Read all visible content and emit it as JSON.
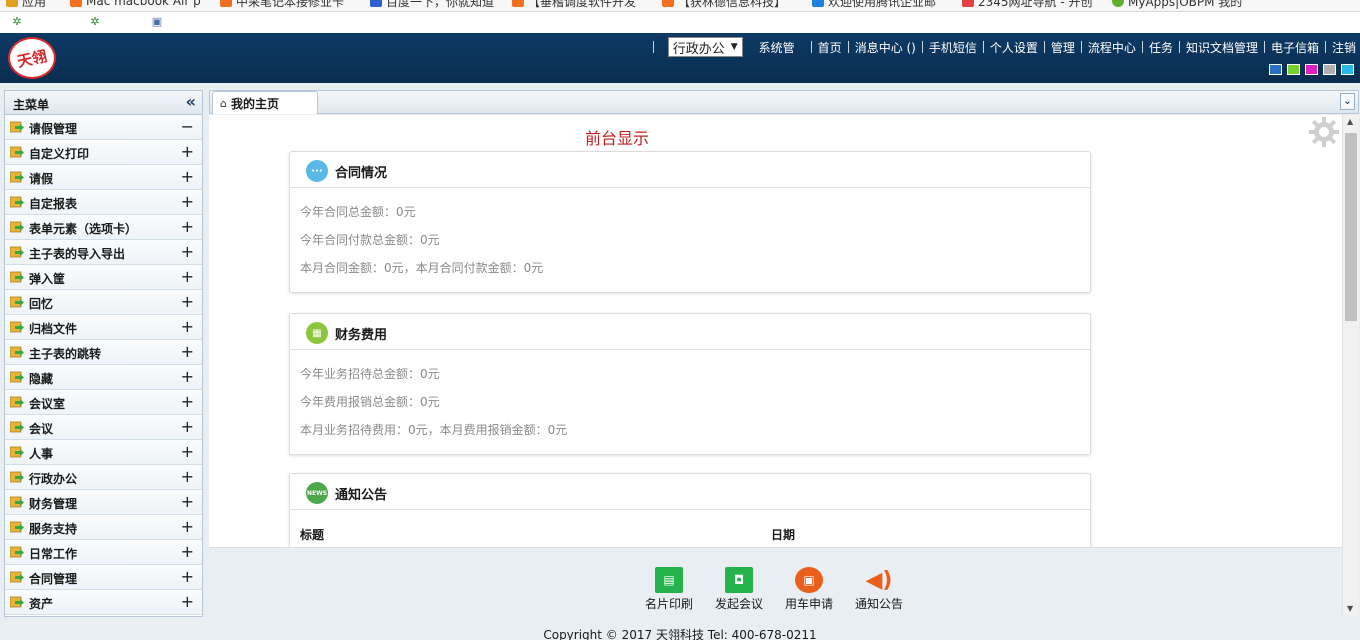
{
  "browser": {
    "bookmarks": [
      "应用",
      "Mac macbook Air p",
      "中采笔记本接修业卡",
      "百度一下，你就知道",
      "【垂稽调度软件开发",
      "【获林德信息科技】",
      "欢迎使用腾讯企业邮",
      "2345网址导航 - 开创",
      "MyApps|OBPM 我的"
    ]
  },
  "header": {
    "logo_text": "天翎",
    "role_select": "行政办公",
    "system_label": "系统管",
    "nav": [
      "首页",
      "消息中心 ()",
      "手机短信",
      "个人设置",
      "管理",
      "流程中心",
      "任务",
      "知识文档管理",
      "电子信箱",
      "注销"
    ],
    "theme_colors": [
      "#2b6fc4",
      "#7ad12c",
      "#e020c0",
      "#b0b0b0",
      "#2ab8e8"
    ]
  },
  "sidebar": {
    "title": "主菜单",
    "items": [
      {
        "label": "请假管理",
        "toggle": "−"
      },
      {
        "label": "自定义打印",
        "toggle": "+"
      },
      {
        "label": "请假",
        "toggle": "+"
      },
      {
        "label": "自定报表",
        "toggle": "+"
      },
      {
        "label": "表单元素（选项卡）",
        "toggle": "+"
      },
      {
        "label": "主子表的导入导出",
        "toggle": "+"
      },
      {
        "label": "弹入筐",
        "toggle": "+"
      },
      {
        "label": "回忆",
        "toggle": "+"
      },
      {
        "label": "归档文件",
        "toggle": "+"
      },
      {
        "label": "主子表的跳转",
        "toggle": "+"
      },
      {
        "label": "隐藏",
        "toggle": "+"
      },
      {
        "label": "会议室",
        "toggle": "+"
      },
      {
        "label": "会议",
        "toggle": "+"
      },
      {
        "label": "人事",
        "toggle": "+"
      },
      {
        "label": "行政办公",
        "toggle": "+"
      },
      {
        "label": "财务管理",
        "toggle": "+"
      },
      {
        "label": "服务支持",
        "toggle": "+"
      },
      {
        "label": "日常工作",
        "toggle": "+"
      },
      {
        "label": "合同管理",
        "toggle": "+"
      },
      {
        "label": "资产",
        "toggle": "+"
      }
    ]
  },
  "tabs": {
    "home_label": "我的主页"
  },
  "main": {
    "frontend_title": "前台显示",
    "contract": {
      "title": "合同情况",
      "lines": [
        "今年合同总金额：0元",
        "今年合同付款总金额：0元",
        "本月合同金额：0元，本月合同付款金额：0元"
      ]
    },
    "finance": {
      "title": "财务费用",
      "lines": [
        "今年业务招待总金额：0元",
        "今年费用报销总金额：0元",
        "本月业务招待费用：0元，本月费用报销金额：0元"
      ]
    },
    "notice": {
      "title": "通知公告",
      "icon_text": "NEWS",
      "col_title": "标题",
      "col_date": "日期"
    }
  },
  "quickbar": {
    "items": [
      "名片印刷",
      "发起会议",
      "用车申请",
      "通知公告"
    ]
  },
  "footer": {
    "text": "Copyright © 2017 天翎科技 Tel: 400-678-0211"
  }
}
